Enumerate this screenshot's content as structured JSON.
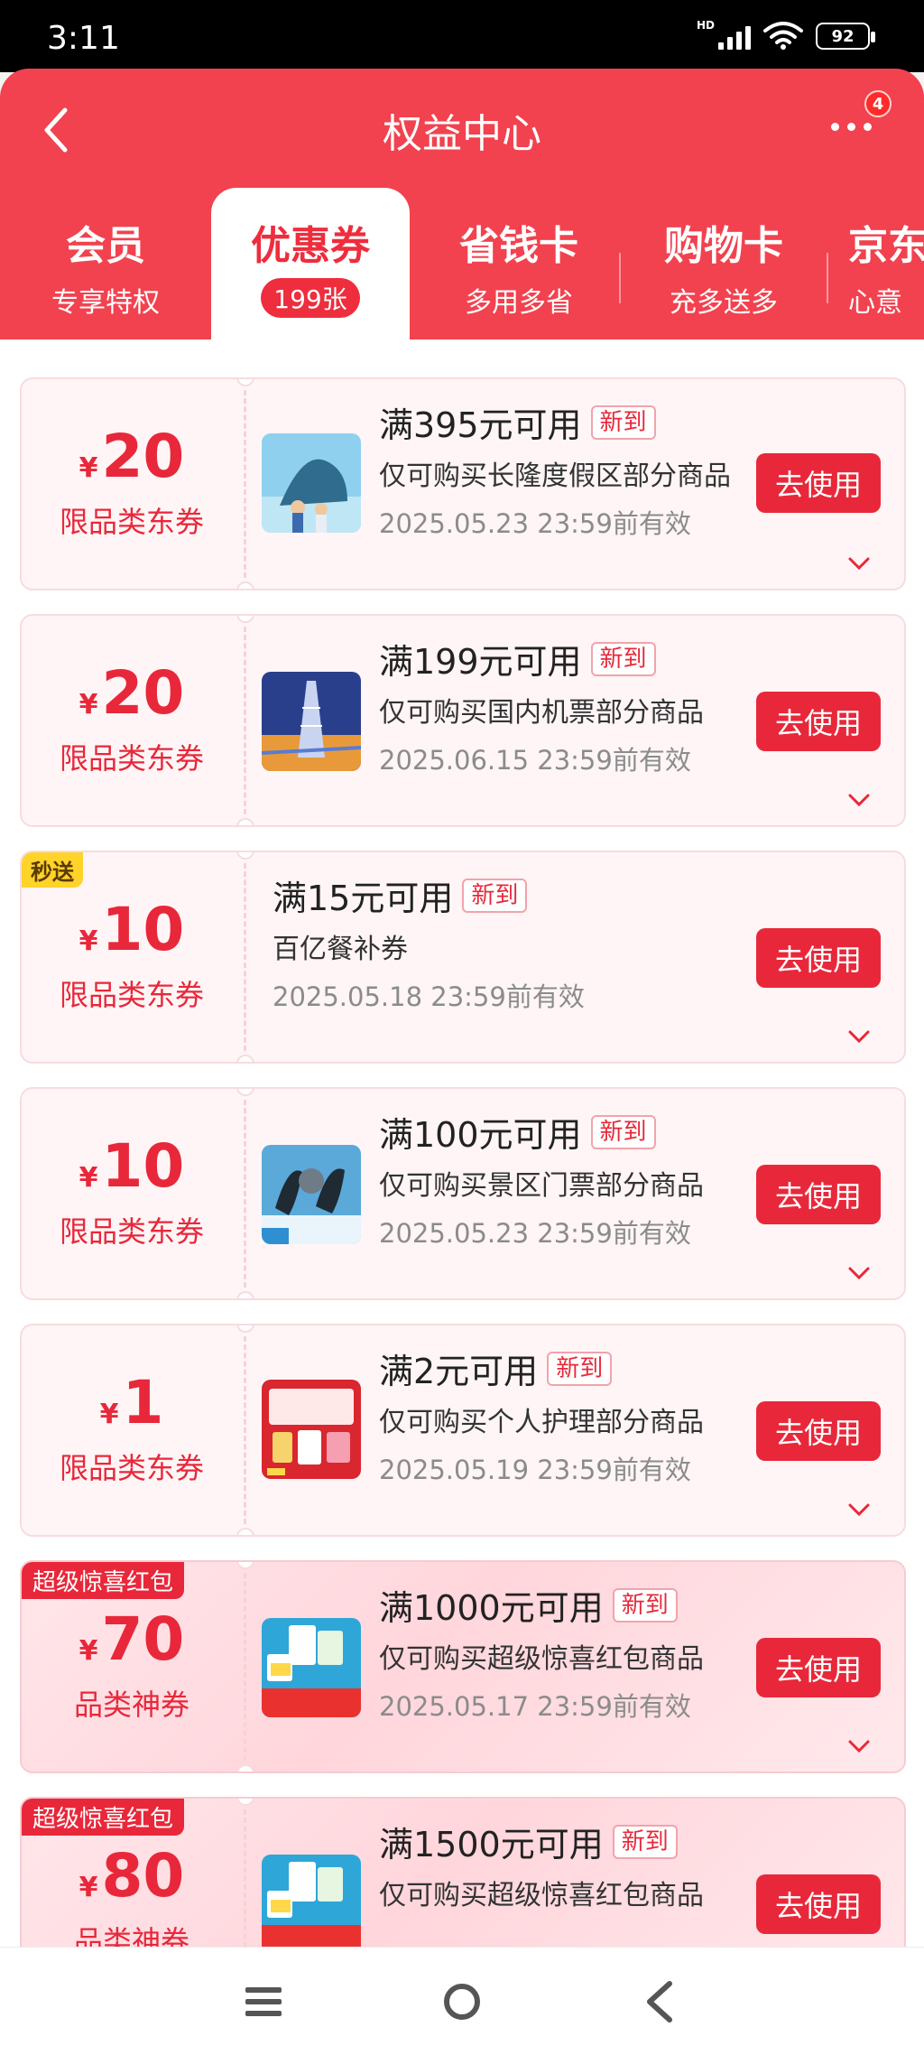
{
  "status_bar": {
    "time": "3:11",
    "network": "HD",
    "battery": "92"
  },
  "header": {
    "title": "权益中心",
    "more_badge": "4"
  },
  "tabs": [
    {
      "title": "会员",
      "subtitle": "专享特权"
    },
    {
      "title": "优惠券",
      "subtitle": "199张"
    },
    {
      "title": "省钱卡",
      "subtitle": "多用多省"
    },
    {
      "title": "购物卡",
      "subtitle": "充多送多"
    },
    {
      "title": "京东",
      "subtitle": "心意"
    }
  ],
  "coupons": [
    {
      "amount": "20",
      "type": "限品类东券",
      "condition": "满395元可用",
      "new": "新到",
      "desc": "仅可购买长隆度假区部分商品",
      "expire": "2025.05.23 23:59前有效",
      "button": "去使用",
      "thumb": "shark-resort-icon"
    },
    {
      "amount": "20",
      "type": "限品类东券",
      "condition": "满199元可用",
      "new": "新到",
      "desc": "仅可购买国内机票部分商品",
      "expire": "2025.06.15 23:59前有效",
      "button": "去使用",
      "thumb": "tower-icon"
    },
    {
      "badge": "秒送",
      "amount": "10",
      "type": "限品类东券",
      "condition": "满15元可用",
      "new": "新到",
      "desc": "百亿餐补券",
      "expire": "2025.05.18 23:59前有效",
      "button": "去使用"
    },
    {
      "amount": "10",
      "type": "限品类东券",
      "condition": "满100元可用",
      "new": "新到",
      "desc": "仅可购买景区门票部分商品",
      "expire": "2025.05.23 23:59前有效",
      "button": "去使用",
      "thumb": "aquarium-icon"
    },
    {
      "amount": "1",
      "type": "限品类东券",
      "condition": "满2元可用",
      "new": "新到",
      "desc": "仅可购买个人护理部分商品",
      "expire": "2025.05.19 23:59前有效",
      "button": "去使用",
      "thumb": "personal-care-icon"
    },
    {
      "badge": "超级惊喜红包",
      "amount": "70",
      "type": "品类神券",
      "condition": "满1000元可用",
      "new": "新到",
      "desc": "仅可购买超级惊喜红包商品",
      "expire": "2025.05.17 23:59前有效",
      "button": "去使用",
      "thumb": "milk-promo-icon"
    },
    {
      "badge": "超级惊喜红包",
      "amount": "80",
      "type": "品类神券",
      "condition": "满1500元可用",
      "new": "新到",
      "desc": "仅可购买超级惊喜红包商品",
      "button": "去使用",
      "thumb": "milk-promo-icon"
    }
  ],
  "currency": "¥",
  "nav": {
    "menu": "menu-icon",
    "home": "home-icon",
    "back": "back-icon"
  }
}
